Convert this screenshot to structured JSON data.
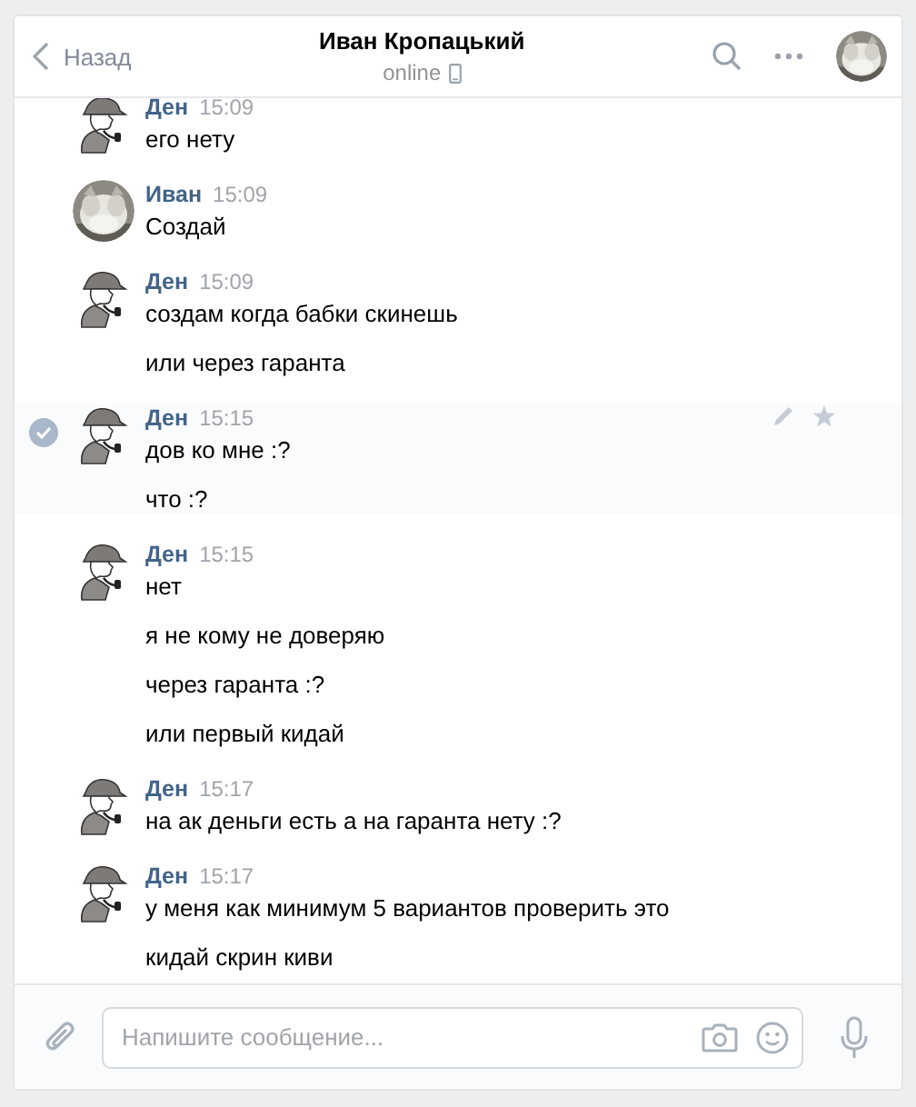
{
  "header": {
    "back": "Назад",
    "title": "Иван Кропацький",
    "status": "online"
  },
  "messages": [
    {
      "author": "Ден",
      "time": "15:09",
      "kind": "drawing",
      "selected": false,
      "lines": [
        "его нету"
      ]
    },
    {
      "author": "Иван",
      "time": "15:09",
      "kind": "picture",
      "selected": false,
      "lines": [
        "Создай"
      ]
    },
    {
      "author": "Ден",
      "time": "15:09",
      "kind": "drawing",
      "selected": false,
      "lines": [
        "создам когда бабки скинешь",
        "или через гаранта"
      ]
    },
    {
      "author": "Ден",
      "time": "15:15",
      "kind": "drawing",
      "selected": true,
      "lines": [
        "дов ко мне :?",
        "что :?"
      ]
    },
    {
      "author": "Ден",
      "time": "15:15",
      "kind": "drawing",
      "selected": false,
      "lines": [
        "нет",
        "я не кому не доверяю",
        "через гаранта :?",
        "или первый кидай"
      ]
    },
    {
      "author": "Ден",
      "time": "15:17",
      "kind": "drawing",
      "selected": false,
      "lines": [
        "на ак деньги есть а на гаранта нету :?"
      ]
    },
    {
      "author": "Ден",
      "time": "15:17",
      "kind": "drawing",
      "selected": false,
      "lines": [
        "у меня как минимум 5 вариантов проверить это",
        "кидай скрин киви"
      ]
    }
  ],
  "composer": {
    "placeholder": "Напишите сообщение..."
  }
}
